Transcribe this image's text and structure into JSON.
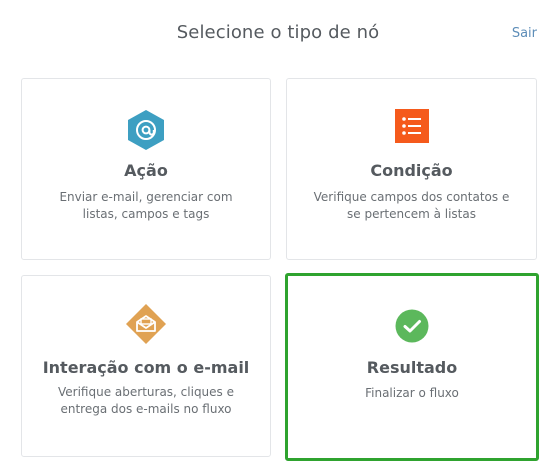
{
  "header": {
    "title": "Selecione o tipo de nó",
    "exit_label": "Sair"
  },
  "cards": [
    {
      "title": "Ação",
      "description": "Enviar e-mail, gerenciar com listas, campos e tags",
      "icon": "at-sign-icon",
      "icon_color": "#3d9fc2"
    },
    {
      "title": "Condição",
      "description": "Verifique campos dos contatos e se pertencem à listas",
      "icon": "list-icon",
      "icon_color": "#f55a1c"
    },
    {
      "title": "Interação com o e-mail",
      "description": "Verifique aberturas, cliques e entrega dos e-mails no fluxo",
      "icon": "open-envelope-icon",
      "icon_color": "#e0a253"
    },
    {
      "title": "Resultado",
      "description": "Finalizar o fluxo",
      "icon": "checkmark-icon",
      "icon_color": "#5cb85c",
      "selected": true
    }
  ],
  "colors": {
    "selected_border": "#2fa32f",
    "exit_link": "#5d8db8"
  }
}
